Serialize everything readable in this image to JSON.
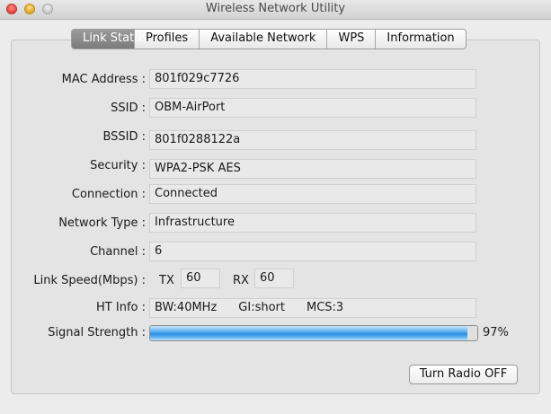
{
  "window": {
    "title": "Wireless Network Utility"
  },
  "tabs": [
    {
      "label": "Link Status",
      "active": true
    },
    {
      "label": "Profiles",
      "active": false
    },
    {
      "label": "Available Network",
      "active": false
    },
    {
      "label": "WPS",
      "active": false
    },
    {
      "label": "Information",
      "active": false
    }
  ],
  "fields": {
    "mac_address": {
      "label": "MAC Address :",
      "value": "801f029c7726"
    },
    "ssid": {
      "label": "SSID :",
      "value": "OBM-AirPort"
    },
    "bssid": {
      "label": "BSSID :",
      "value": "801f0288122a"
    },
    "security": {
      "label": "Security :",
      "value": "WPA2-PSK AES"
    },
    "connection": {
      "label": "Connection :",
      "value": "Connected"
    },
    "network_type": {
      "label": "Network Type :",
      "value": "Infrastructure"
    },
    "channel": {
      "label": "Channel :",
      "value": "6"
    },
    "link_speed": {
      "label": "Link Speed(Mbps) :",
      "tx_label": "TX",
      "tx_value": "60",
      "rx_label": "RX",
      "rx_value": "60"
    },
    "ht_info": {
      "label": "HT Info :",
      "bw": "BW:40MHz",
      "gi": "GI:short",
      "mcs": "MCS:3"
    },
    "signal_strength": {
      "label": "Signal Strength :",
      "percent": 97,
      "percent_label": "97%"
    }
  },
  "buttons": {
    "turn_radio_off": "Turn Radio OFF"
  },
  "colors": {
    "progress_accent": "#2b8fe6",
    "active_tab": "#8a8a8a"
  }
}
